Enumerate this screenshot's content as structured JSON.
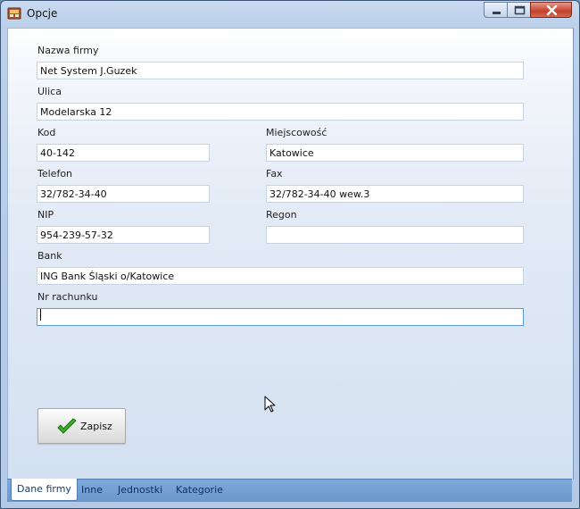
{
  "window": {
    "title": "Opcje"
  },
  "form": {
    "company_name": {
      "label": "Nazwa firmy",
      "value": "Net System J.Guzek"
    },
    "street": {
      "label": "Ulica",
      "value": "Modelarska 12"
    },
    "postal_code": {
      "label": "Kod",
      "value": "40-142"
    },
    "city": {
      "label": "Miejscowość",
      "value": "Katowice"
    },
    "phone": {
      "label": "Telefon",
      "value": "32/782-34-40"
    },
    "fax": {
      "label": "Fax",
      "value": "32/782-34-40 wew.3"
    },
    "nip": {
      "label": "NIP",
      "value": "954-239-57-32"
    },
    "regon": {
      "label": "Regon",
      "value": ""
    },
    "bank": {
      "label": "Bank",
      "value": "ING Bank Śląski o/Katowice"
    },
    "account_number": {
      "label": "Nr rachunku",
      "value": ""
    }
  },
  "save_button": {
    "label": "Zapisz",
    "icon": "check-icon"
  },
  "tabs": [
    {
      "label": "Dane firmy",
      "selected": true
    },
    {
      "label": "Inne",
      "selected": false
    },
    {
      "label": "Jednostki",
      "selected": false
    },
    {
      "label": "Kategorie",
      "selected": false
    }
  ],
  "colors": {
    "accent": "#5b9ad6",
    "tab_bar": "#6b97cc",
    "close_button": "#c4412b"
  }
}
